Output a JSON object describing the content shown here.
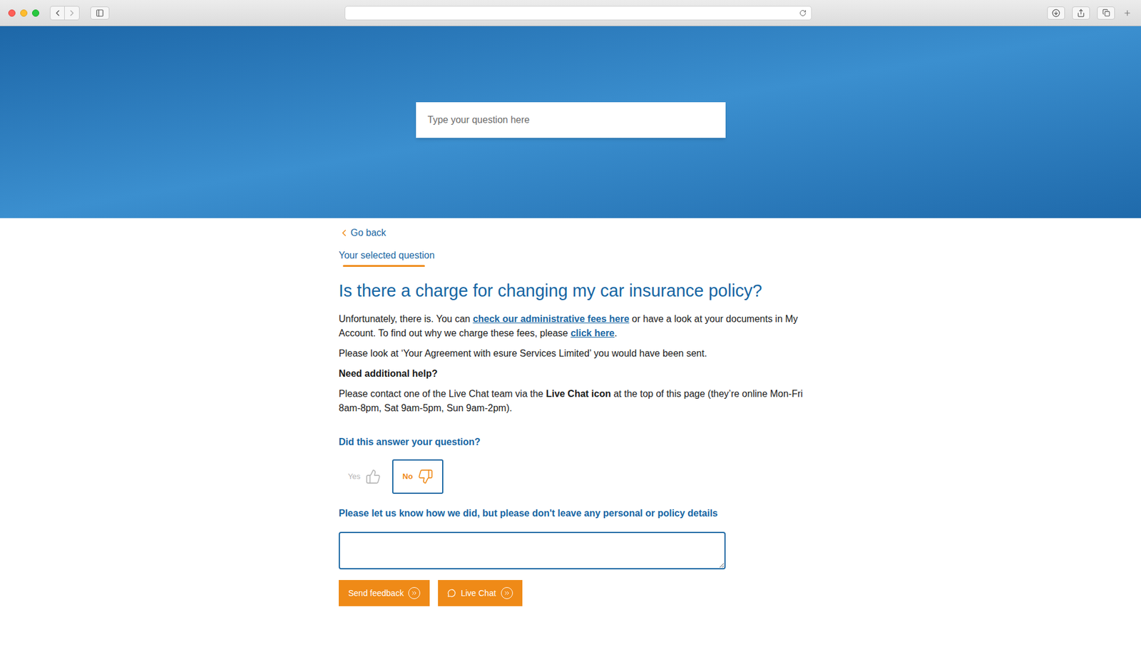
{
  "browser": {
    "address": ""
  },
  "hero": {
    "search_placeholder": "Type your question here"
  },
  "nav": {
    "back": "Go back",
    "tab": "Your selected question"
  },
  "question": "Is there a charge for changing my car insurance policy?",
  "answer": [
    [
      {
        "text": "Unfortunately, there is. You can ",
        "kind": "text"
      },
      {
        "text": "check our administrative fees here",
        "kind": "link"
      },
      {
        "text": " or have a look at your documents in My Account. To find out why we charge these fees, please ",
        "kind": "text"
      },
      {
        "text": "click here",
        "kind": "link"
      },
      {
        "text": ".",
        "kind": "text"
      }
    ],
    [
      {
        "text": "Please look at ‘Your Agreement with esure Services Limited’ you would have been sent.",
        "kind": "text"
      }
    ],
    [
      {
        "text": "Need additional help?",
        "kind": "bold"
      }
    ],
    [
      {
        "text": "Please contact one of the Live Chat team via the ",
        "kind": "text"
      },
      {
        "text": "Live Chat icon",
        "kind": "bold"
      },
      {
        "text": " at the top of this page (they’re online Mon-Fri 8am-8pm, Sat 9am-5pm, Sun 9am-2pm).",
        "kind": "text"
      }
    ]
  ],
  "feedback": {
    "question": "Did this answer your question?",
    "options": [
      {
        "label": "Yes",
        "selected": false,
        "kind": "up"
      },
      {
        "label": "No",
        "selected": true,
        "kind": "down"
      }
    ],
    "comment_label": "Please let us know how we did, but please don't leave any personal or policy details",
    "comment_value": "",
    "buttons": [
      {
        "label": "Send feedback",
        "kind": "send"
      },
      {
        "label": "Live Chat",
        "kind": "chat"
      }
    ]
  }
}
